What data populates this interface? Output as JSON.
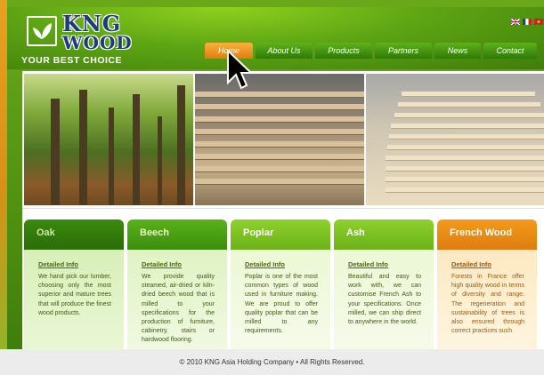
{
  "brand": {
    "name_line1": "KNG",
    "name_line2": "WOOD",
    "tagline": "YOUR BEST CHOICE"
  },
  "nav": {
    "items": [
      {
        "label": "Home",
        "active": true
      },
      {
        "label": "About Us"
      },
      {
        "label": "Products"
      },
      {
        "label": "Partners"
      },
      {
        "label": "News"
      },
      {
        "label": "Contact"
      }
    ]
  },
  "languages": [
    "english-flag-icon",
    "french-flag-icon",
    "vietnam-flag-icon"
  ],
  "cards": [
    {
      "title": "Oak",
      "link": "Detailed Info",
      "text": "We hand pick our lumber, choosing only the most superior and mature trees that will produce the finest wood products."
    },
    {
      "title": "Beech",
      "link": "Detailed Info",
      "text": "We provide quality steamed, air-dried or kiln-dried beech wood that is milled to your specifications for the production of furniture, cabinetry, stairs or hardwood flooring."
    },
    {
      "title": "Poplar",
      "link": "Detailed Info",
      "text": "Poplar is one of the most common types of wood used in furniture making. We are proud to offer quality poplar that can be milled to any requirements."
    },
    {
      "title": "Ash",
      "link": "Detailed Info",
      "text": "Beautiful and easy to work with, we can customise French Ash to your specifications. Once milled, we can ship direct to anywhere in the world."
    },
    {
      "title": "French Wood",
      "link": "Detailed Info",
      "text": "Forests in France offer high quality wood in terms of diversity and range. The regeneration and sustainability of trees is also ensured through correct practices such"
    }
  ],
  "footer": {
    "copyright": "© 2010 KNG Asia Holding Company • All Rights Reserved."
  },
  "colors": {
    "header_green": "#5ea514",
    "nav_active": "#e07d10",
    "logo_blue": "#1c3d78"
  }
}
